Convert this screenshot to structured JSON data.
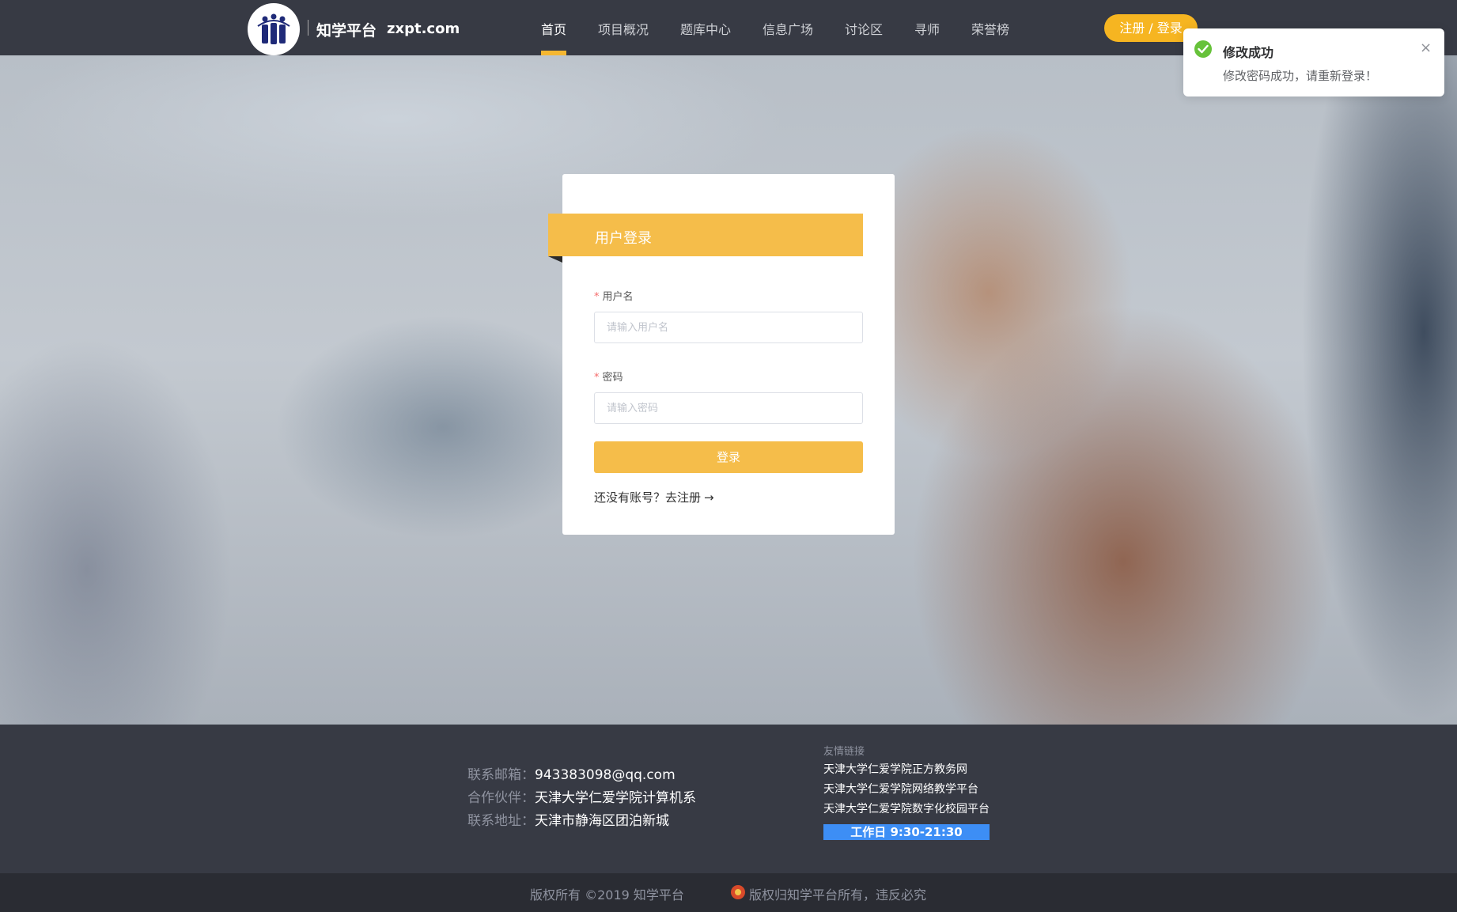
{
  "header": {
    "brand": "知学平台",
    "domain": "zxpt.com",
    "nav": [
      "首页",
      "项目概况",
      "题库中心",
      "信息广场",
      "讨论区",
      "寻师",
      "荣誉榜"
    ],
    "active_index": 0,
    "auth_button": "注册 /  登录"
  },
  "login": {
    "title": "用户登录",
    "username_label": "用户名",
    "username_placeholder": "请输入用户名",
    "username_value": "",
    "password_label": "密码",
    "password_placeholder": "请输入密码",
    "password_value": "",
    "required_mark": "*",
    "submit_label": "登录",
    "register_prompt": "还没有账号？去注册",
    "register_arrow": "→"
  },
  "toast": {
    "title": "修改成功",
    "message": "修改密码成功，请重新登录！",
    "close": "×",
    "icon": "check-circle-icon",
    "color": "#67c23a"
  },
  "footer": {
    "contacts": [
      {
        "key": "联系邮箱：",
        "value": "943383098@qq.com"
      },
      {
        "key": "合作伙伴：",
        "value": "天津大学仁爱学院计算机系"
      },
      {
        "key": "联系地址：",
        "value": "天津市静海区团泊新城"
      }
    ],
    "links_title": "友情链接",
    "links": [
      "天津大学仁爱学院正方教务网",
      "天津大学仁爱学院网络教学平台",
      "天津大学仁爱学院数字化校园平台"
    ],
    "hours": "工作日 9:30-21:30",
    "copyright_left": "版权所有 ©2019 知学平台",
    "copyright_right": "版权归知学平台所有，违反必究"
  },
  "colors": {
    "accent": "#f5bd4a",
    "header_bg": "#373a44",
    "footer_bg": "#373a44",
    "hours_bg": "#3d8ef5"
  }
}
